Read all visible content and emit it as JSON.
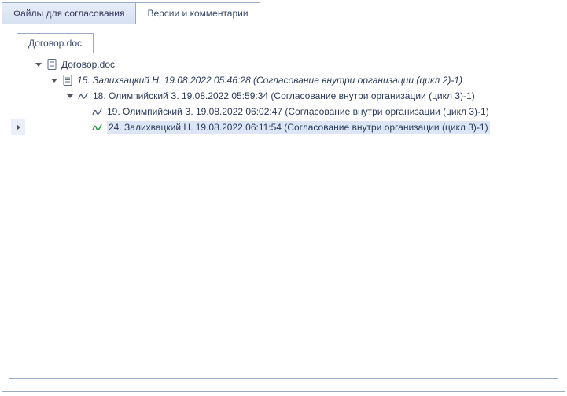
{
  "mainTabs": {
    "inactive": "Файлы для согласования",
    "active": "Версии и комментарии"
  },
  "subTab": "Договор.doc",
  "tree": {
    "root": {
      "label": "Договор.doc"
    },
    "v15": {
      "label": "15. Залихвацкий Н. 19.08.2022 05:46:28 (Согласование внутри организации (цикл 2)-1)"
    },
    "v18": {
      "label": "18. Олимпийский З. 19.08.2022 05:59:34 (Согласование внутри организации (цикл 3)-1)"
    },
    "v19": {
      "label": "19. Олимпийский З. 19.08.2022 06:02:47 (Согласование внутри организации (цикл 3)-1)"
    },
    "v24": {
      "label": "24. Залихвацкий Н. 19.08.2022 06:11:54 (Согласование внутри организации (цикл 3)-1)"
    }
  }
}
